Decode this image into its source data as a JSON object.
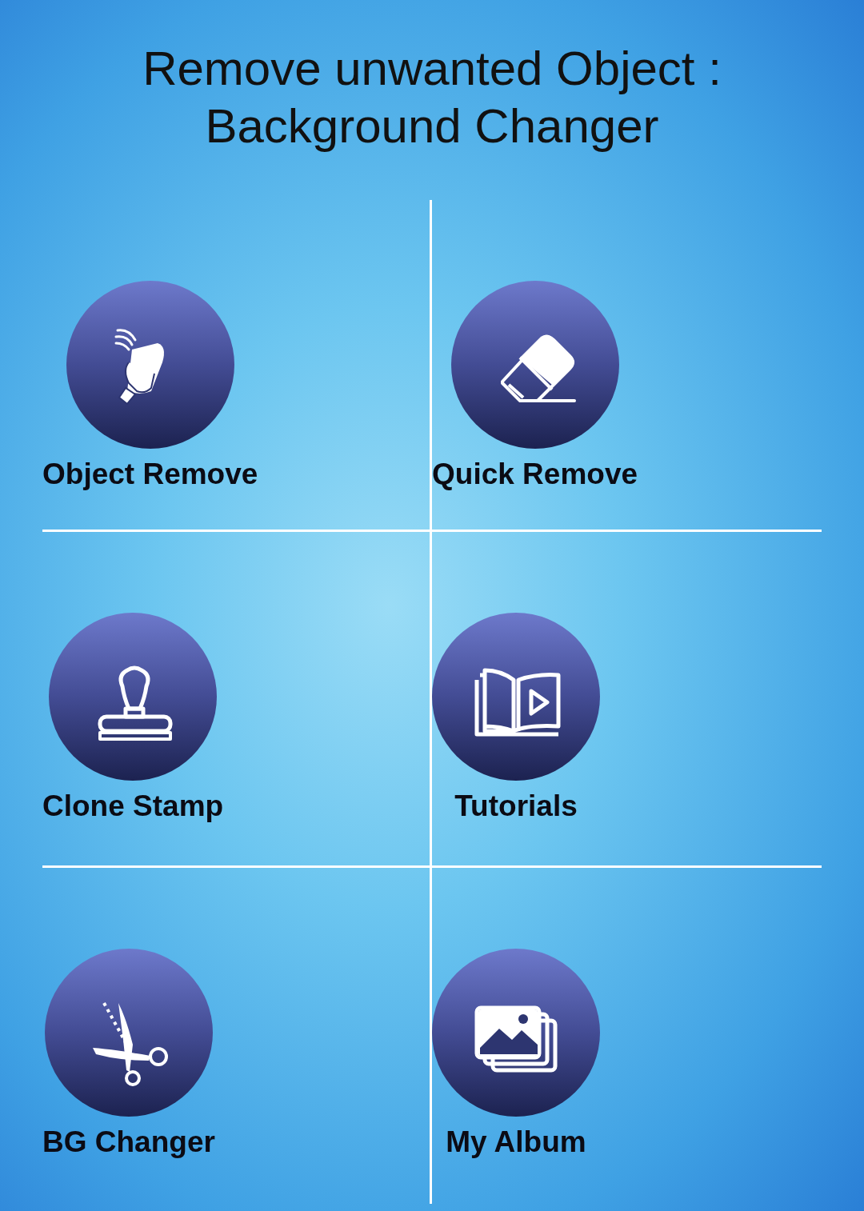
{
  "title": {
    "lines": [
      "Remove unwanted Object :",
      "Background Changer"
    ]
  },
  "tiles": [
    {
      "label": "Object Remove",
      "kind": "wipe"
    },
    {
      "label": "Quick Remove",
      "kind": "eraser"
    },
    {
      "label": "Clone Stamp",
      "kind": "stamp"
    },
    {
      "label": "Tutorials",
      "kind": "book"
    },
    {
      "label": "BG Changer",
      "kind": "scissors"
    },
    {
      "label": "My Album",
      "kind": "album"
    }
  ]
}
